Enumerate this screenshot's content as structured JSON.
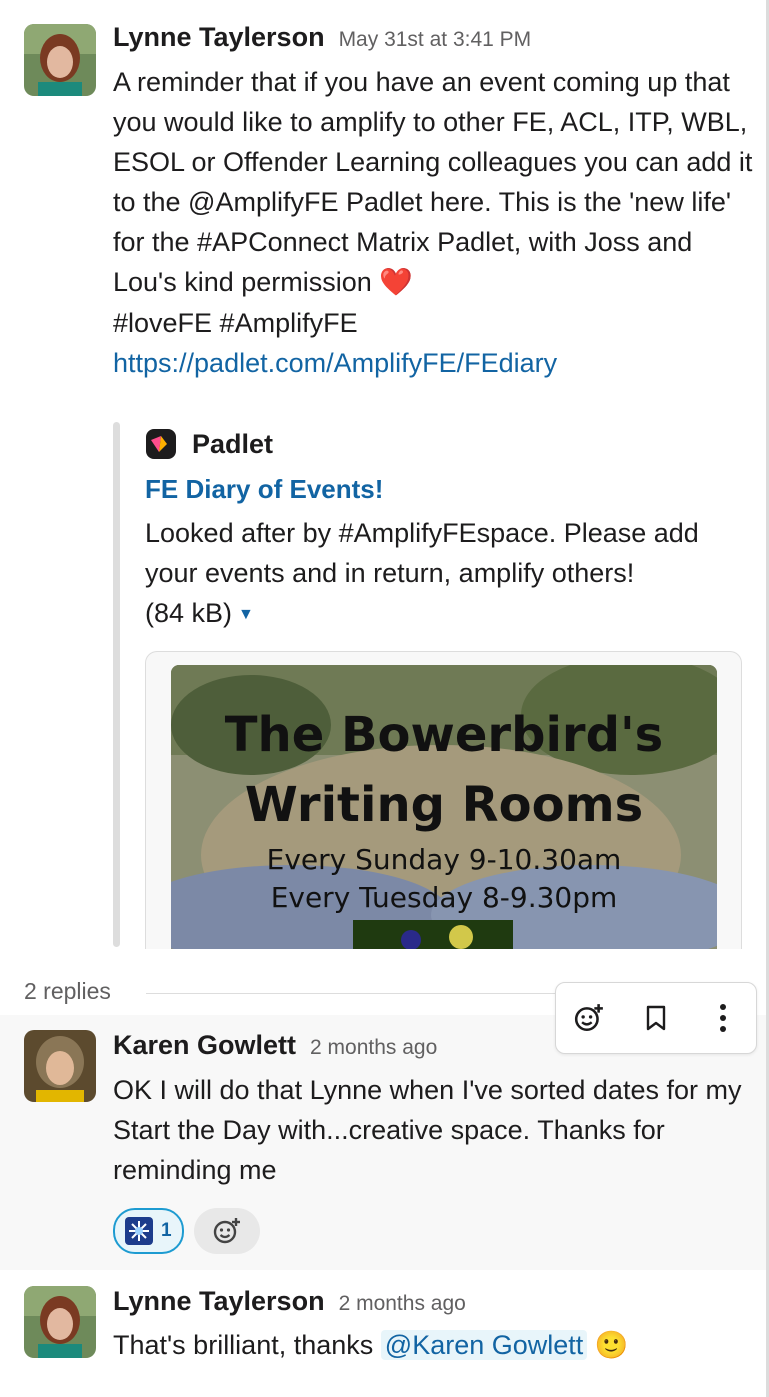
{
  "messages": [
    {
      "author": "Lynne Taylerson",
      "time": "May 31st at 3:41 PM",
      "text": "A reminder that if you have an event coming up that you would like to amplify to other FE, ACL, ITP, WBL, ESOL or Offender Learning colleagues you can add it to the @AmplifyFE Padlet here. This is the 'new life' for the #APConnect Matrix Padlet, with Joss and Lou's kind permission",
      "emoji": "❤️",
      "text_tail": "#loveFE #AmplifyFE",
      "link": "https://padlet.com/AmplifyFE/FEdiary",
      "attachment": {
        "service": "Padlet",
        "title": "FE Diary of Events!",
        "description": "Looked after by #AmplifyFEspace. Please add your events and in return, amplify others!",
        "size": "(84 kB)",
        "preview_title_line1": "The Bowerbird's",
        "preview_title_line2": "Writing Rooms",
        "preview_line3": "Every Sunday 9-10.30am",
        "preview_line4": "Every Tuesday 8-9.30pm"
      }
    }
  ],
  "thread": {
    "replies_label": "2 replies",
    "replies": [
      {
        "author": "Karen Gowlett",
        "time": "2 months ago",
        "text": "OK I will do that Lynne when I've sorted dates for my Start the Day with...creative space. Thanks for reminding me",
        "reactions": [
          {
            "icon": "sparkler",
            "count": "1"
          }
        ]
      },
      {
        "author": "Lynne Taylerson",
        "time": "2 months ago",
        "text": "That's brilliant, thanks",
        "mention": "@Karen Gowlett",
        "emoji": "🙂"
      }
    ]
  },
  "actions": [
    "add-reaction-icon",
    "bookmark-icon",
    "more-actions-icon"
  ],
  "colors": {
    "link": "#1264a3",
    "text": "#1d1c1d",
    "muted": "#616061",
    "thread_bg": "#f8f8f8"
  }
}
